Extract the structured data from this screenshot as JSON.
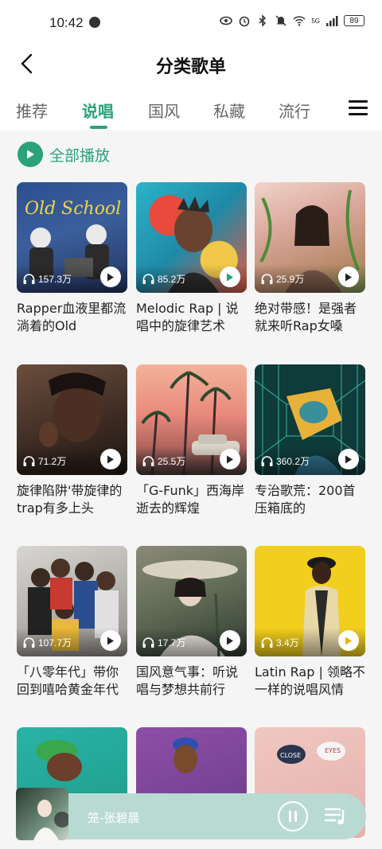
{
  "status_bar": {
    "time": "10:42",
    "battery": "89",
    "network": "5G",
    "icons": [
      "eye-icon",
      "alarm-icon",
      "bluetooth-icon",
      "mute-icon",
      "wifi-icon",
      "signal-icon",
      "battery-icon"
    ]
  },
  "header": {
    "title": "分类歌单",
    "back_icon": "back-arrow-icon"
  },
  "tabs": [
    {
      "label": "推荐",
      "active": false
    },
    {
      "label": "说唱",
      "active": true
    },
    {
      "label": "国风",
      "active": false
    },
    {
      "label": "私藏",
      "active": false
    },
    {
      "label": "流行",
      "active": false
    }
  ],
  "accent_color": "#2aa27a",
  "play_all": {
    "label": "全部播放"
  },
  "playlists": [
    {
      "title": "Rapper血液里都流淌着的Old",
      "plays": "157.3万"
    },
    {
      "title": "Melodic Rap | 说唱中的旋律艺术",
      "plays": "85.2万"
    },
    {
      "title": "绝对带感！是强者就来听Rap女嗓",
      "plays": "25.9万"
    },
    {
      "title": "旋律陷阱'带旋律的trap有多上头",
      "plays": "71.2万"
    },
    {
      "title": "「G-Funk」西海岸逝去的辉煌",
      "plays": "25.5万"
    },
    {
      "title": "专治歌荒：200首压箱底的",
      "plays": "360.2万"
    },
    {
      "title": "「八零年代」带你回到嘻哈黄金年代",
      "plays": "107.7万"
    },
    {
      "title": "国风意气事：听说唱与梦想共前行",
      "plays": "17.7万"
    },
    {
      "title": "Latin Rap | 领略不一样的说唱风情",
      "plays": "3.4万"
    }
  ],
  "mini_player": {
    "song": "笼-张碧晨",
    "state": "playing"
  }
}
